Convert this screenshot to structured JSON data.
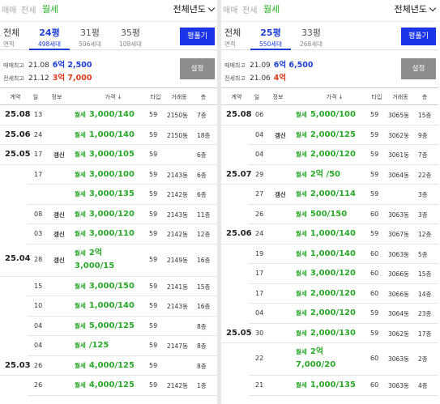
{
  "panels": [
    {
      "deal_tabs": [
        "매매",
        "전세",
        "월세"
      ],
      "active_tab": 2,
      "year_select": "전체년도",
      "size_all": {
        "label": "전체",
        "sub": "면적"
      },
      "sizes": [
        {
          "py": "24평",
          "count": "498세대",
          "active": true
        },
        {
          "py": "31평",
          "count": "506세대",
          "active": false
        },
        {
          "py": "35평",
          "count": "108세대",
          "active": false
        }
      ],
      "measure_btn": "평풀기",
      "sale_high": {
        "label": "매매최고",
        "date": "21.08",
        "price": "6억 2,500"
      },
      "jeonse_high": {
        "label": "전세최고",
        "date": "21.12",
        "price": "3억 7,000"
      },
      "settings_btn": "설정",
      "headers": [
        "계약",
        "일",
        "정보",
        "가격 ↓",
        "타입",
        "거래동",
        "층"
      ],
      "rows": [
        {
          "date": "25.08",
          "day": "13",
          "info": "",
          "kind": "월세",
          "price": "3,000/140",
          "price2": "",
          "type": "59",
          "dong": "2150동",
          "floor": "7층"
        },
        {
          "date": "25.06",
          "day": "24",
          "info": "",
          "kind": "월세",
          "price": "1,000/140",
          "price2": "",
          "type": "59",
          "dong": "2150동",
          "floor": "18층"
        },
        {
          "date": "25.05",
          "day": "17",
          "info": "갱신",
          "kind": "월세",
          "price": "3,000/105",
          "price2": "",
          "type": "59",
          "dong": "",
          "floor": "6층"
        },
        {
          "date": "",
          "day": "17",
          "info": "",
          "kind": "월세",
          "price": "3,000/100",
          "price2": "",
          "type": "59",
          "dong": "2143동",
          "floor": "6층"
        },
        {
          "date": "",
          "day": "",
          "info": "",
          "kind": "월세",
          "price": "3,000/135",
          "price2": "",
          "type": "59",
          "dong": "2142동",
          "floor": "6층"
        },
        {
          "date": "",
          "day": "08",
          "info": "갱신",
          "kind": "월세",
          "price": "3,000/120",
          "price2": "",
          "type": "59",
          "dong": "2143동",
          "floor": "11층"
        },
        {
          "date": "",
          "day": "03",
          "info": "갱신",
          "kind": "월세",
          "price": "3,000/110",
          "price2": "",
          "type": "59",
          "dong": "2142동",
          "floor": "12층"
        },
        {
          "date": "25.04",
          "day": "28",
          "info": "갱신",
          "kind": "월세",
          "price": "2억",
          "price2": "3,000/15",
          "type": "59",
          "dong": "2149동",
          "floor": "16층"
        },
        {
          "date": "",
          "day": "15",
          "info": "",
          "kind": "월세",
          "price": "3,000/150",
          "price2": "",
          "type": "59",
          "dong": "2141동",
          "floor": "15층"
        },
        {
          "date": "",
          "day": "10",
          "info": "",
          "kind": "월세",
          "price": "1,000/140",
          "price2": "",
          "type": "59",
          "dong": "2143동",
          "floor": "16층"
        },
        {
          "date": "",
          "day": "04",
          "info": "",
          "kind": "월세",
          "price": "5,000/125",
          "price2": "",
          "type": "59",
          "dong": "",
          "floor": "8층"
        },
        {
          "date": "",
          "day": "04",
          "info": "",
          "kind": "월세",
          "price": "/125",
          "price2": "",
          "type": "59",
          "dong": "2147동",
          "floor": "8층"
        },
        {
          "date": "25.03",
          "day": "26",
          "info": "",
          "kind": "월세",
          "price": "4,000/125",
          "price2": "",
          "type": "59",
          "dong": "",
          "floor": "8층"
        },
        {
          "date": "",
          "day": "26",
          "info": "",
          "kind": "월세",
          "price": "4,000/125",
          "price2": "",
          "type": "59",
          "dong": "2142동",
          "floor": "1층"
        }
      ]
    },
    {
      "deal_tabs": [
        "매매",
        "전세",
        "월세"
      ],
      "active_tab": 2,
      "year_select": "전체년도",
      "size_all": {
        "label": "전체",
        "sub": "면적"
      },
      "sizes": [
        {
          "py": "25평",
          "count": "550세대",
          "active": true
        },
        {
          "py": "33평",
          "count": "268세대",
          "active": false
        }
      ],
      "measure_btn": "평풀기",
      "sale_high": {
        "label": "매매최고",
        "date": "21.09",
        "price": "6억 6,500"
      },
      "jeonse_high": {
        "label": "전세최고",
        "date": "21.06",
        "price": "4억"
      },
      "settings_btn": "설정",
      "headers": [
        "계약",
        "일",
        "정보",
        "가격 ↓",
        "타입",
        "거래동",
        "층"
      ],
      "rows": [
        {
          "date": "25.08",
          "day": "06",
          "info": "",
          "kind": "월세",
          "price": "5,000/100",
          "price2": "",
          "type": "59",
          "dong": "3065동",
          "floor": "15층"
        },
        {
          "date": "",
          "day": "04",
          "info": "갱신",
          "kind": "월세",
          "price": "2,000/125",
          "price2": "",
          "type": "59",
          "dong": "3062동",
          "floor": "9층"
        },
        {
          "date": "",
          "day": "04",
          "info": "",
          "kind": "월세",
          "price": "2,000/120",
          "price2": "",
          "type": "59",
          "dong": "3061동",
          "floor": "7층"
        },
        {
          "date": "25.07",
          "day": "29",
          "info": "",
          "kind": "월세",
          "price": "2억 /50",
          "price2": "",
          "type": "59",
          "dong": "3064동",
          "floor": "22층"
        },
        {
          "date": "",
          "day": "27",
          "info": "갱신",
          "kind": "월세",
          "price": "2,000/114",
          "price2": "",
          "type": "59",
          "dong": "",
          "floor": "3층"
        },
        {
          "date": "",
          "day": "26",
          "info": "",
          "kind": "월세",
          "price": "500/150",
          "price2": "",
          "type": "60",
          "dong": "3063동",
          "floor": "3층"
        },
        {
          "date": "25.06",
          "day": "24",
          "info": "",
          "kind": "월세",
          "price": "1,000/140",
          "price2": "",
          "type": "59",
          "dong": "3067동",
          "floor": "12층"
        },
        {
          "date": "",
          "day": "19",
          "info": "",
          "kind": "월세",
          "price": "1,000/140",
          "price2": "",
          "type": "60",
          "dong": "3063동",
          "floor": "5층"
        },
        {
          "date": "",
          "day": "17",
          "info": "",
          "kind": "월세",
          "price": "3,000/120",
          "price2": "",
          "type": "60",
          "dong": "3066동",
          "floor": "15층"
        },
        {
          "date": "",
          "day": "17",
          "info": "",
          "kind": "월세",
          "price": "2,000/120",
          "price2": "",
          "type": "60",
          "dong": "3066동",
          "floor": "14층"
        },
        {
          "date": "",
          "day": "04",
          "info": "",
          "kind": "월세",
          "price": "2,000/120",
          "price2": "",
          "type": "59",
          "dong": "3064동",
          "floor": "23층"
        },
        {
          "date": "25.05",
          "day": "30",
          "info": "",
          "kind": "월세",
          "price": "2,000/130",
          "price2": "",
          "type": "59",
          "dong": "3062동",
          "floor": "17층"
        },
        {
          "date": "",
          "day": "22",
          "info": "",
          "kind": "월세",
          "price": "2억",
          "price2": "7,000/20",
          "type": "60",
          "dong": "3063동",
          "floor": "2층"
        },
        {
          "date": "",
          "day": "21",
          "info": "",
          "kind": "월세",
          "price": "1,000/135",
          "price2": "",
          "type": "60",
          "dong": "3063동",
          "floor": "4층"
        }
      ]
    }
  ]
}
